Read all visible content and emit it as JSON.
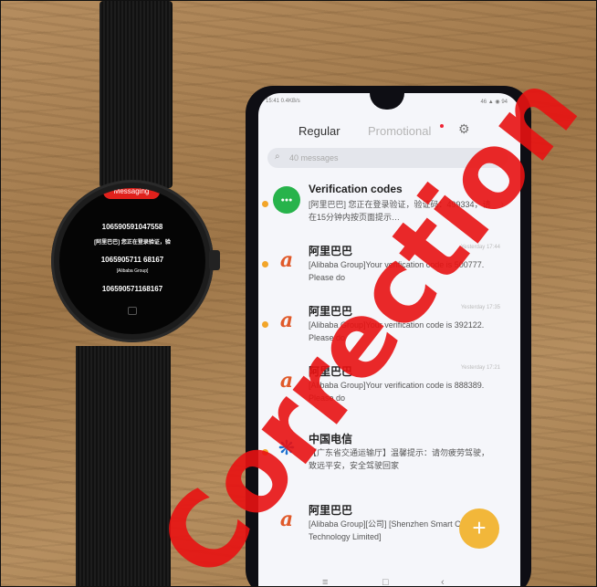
{
  "watch": {
    "app_title": "Messaging",
    "lines": [
      "106590591047558",
      "[阿里巴巴] 您正在登录验证，验",
      "1065905711 68167",
      "[Alibaba Group]",
      "106590571168167"
    ]
  },
  "phone": {
    "status_time": "15:41 0.4KB/s",
    "status_icons": "46 ▲ ◉ 94",
    "tabs": {
      "regular": "Regular",
      "promotional": "Promotional"
    },
    "search_placeholder": "40 messages",
    "messages": [
      {
        "sender": "Verification codes",
        "time": "",
        "preview": "[阿里巴巴] 您正在登录验证，验证码：499334，请在15分钟内按页面提示…",
        "avatar": "verification-icon",
        "unread": true
      },
      {
        "sender": "阿里巴巴",
        "time": "Yesterday 17:44",
        "preview": "[Alibaba Group]Your verification code is 500777.  Please do",
        "avatar": "alibaba-icon",
        "unread": true
      },
      {
        "sender": "阿里巴巴",
        "time": "Yesterday 17:35",
        "preview": "[Alibaba Group]Your verification code is 392122.  Please do",
        "avatar": "alibaba-icon",
        "unread": true
      },
      {
        "sender": "阿里巴巴",
        "time": "Yesterday 17:21",
        "preview": "[Alibaba Group]Your verification code is 888389.  Please do",
        "avatar": "alibaba-icon",
        "unread": false
      },
      {
        "sender": "中国电信",
        "time": "",
        "preview": "【广东省交通运输厅】温馨提示：请勿疲劳驾驶，致远平安，安全驾驶回家",
        "avatar": "china-telecom-icon",
        "unread": true
      },
      {
        "sender": "阿里巴巴",
        "time": "",
        "preview": "[Alibaba Group][公司] [Shenzhen Smart Care Technology Limited]",
        "avatar": "alibaba-icon",
        "unread": false
      }
    ]
  },
  "watermark": "Correction"
}
